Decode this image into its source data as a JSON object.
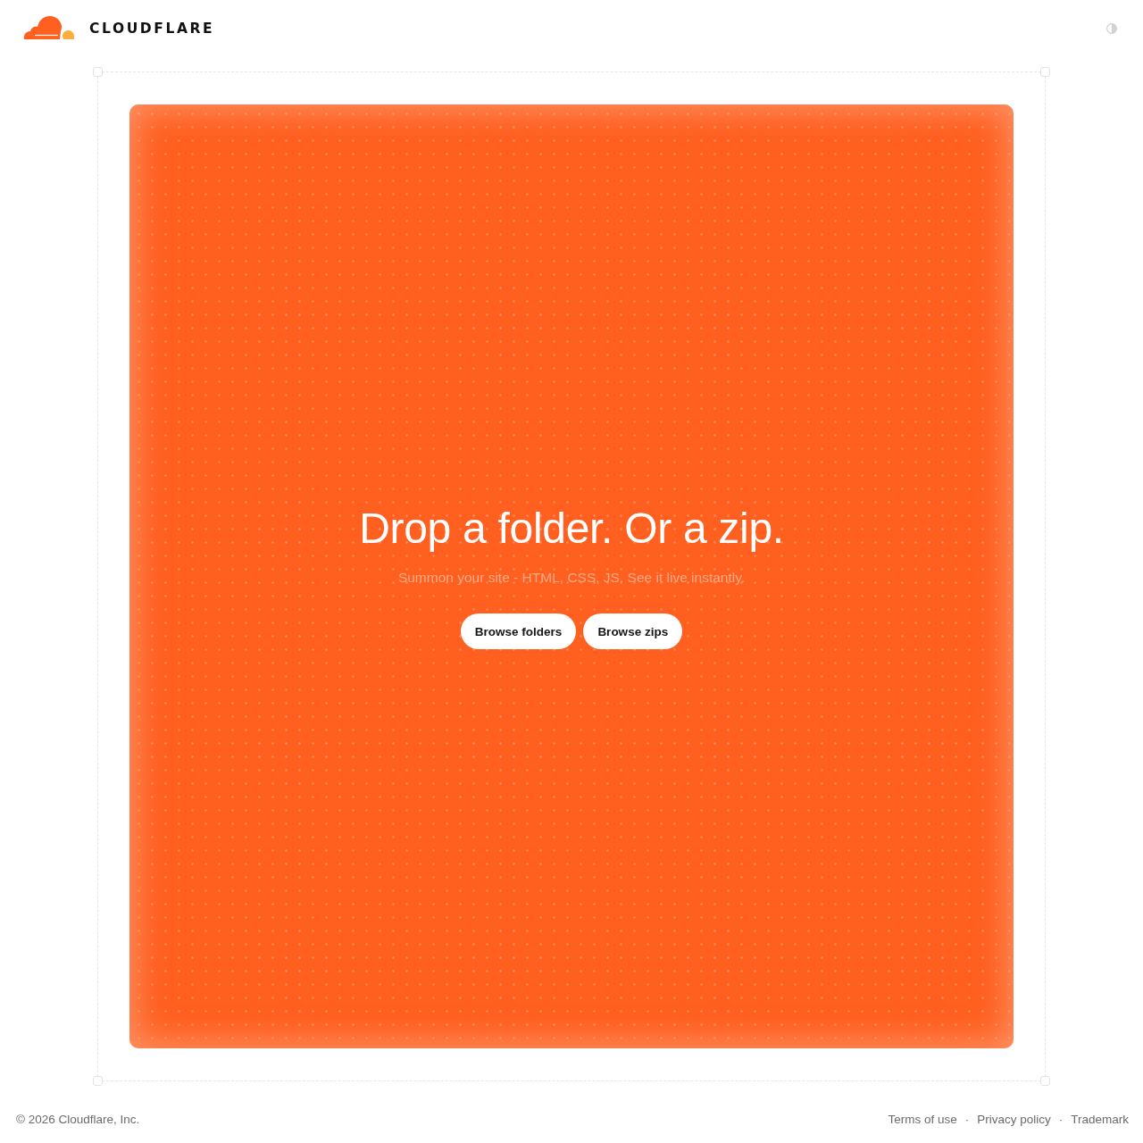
{
  "header": {
    "brand": "CLOUDFLARE"
  },
  "drop_zone": {
    "title": "Drop a folder. Or a zip.",
    "subtitle": "Summon your site - HTML, CSS, JS. See it live instantly.",
    "buttons": [
      {
        "label": "Browse folders"
      },
      {
        "label": "Browse zips"
      }
    ]
  },
  "footer": {
    "copyright": "© 2026 Cloudflare, Inc.",
    "links": [
      {
        "label": "Terms of use"
      },
      {
        "label": "Privacy policy"
      },
      {
        "label": "Trademark"
      }
    ],
    "separators": [
      "·",
      "·"
    ]
  }
}
